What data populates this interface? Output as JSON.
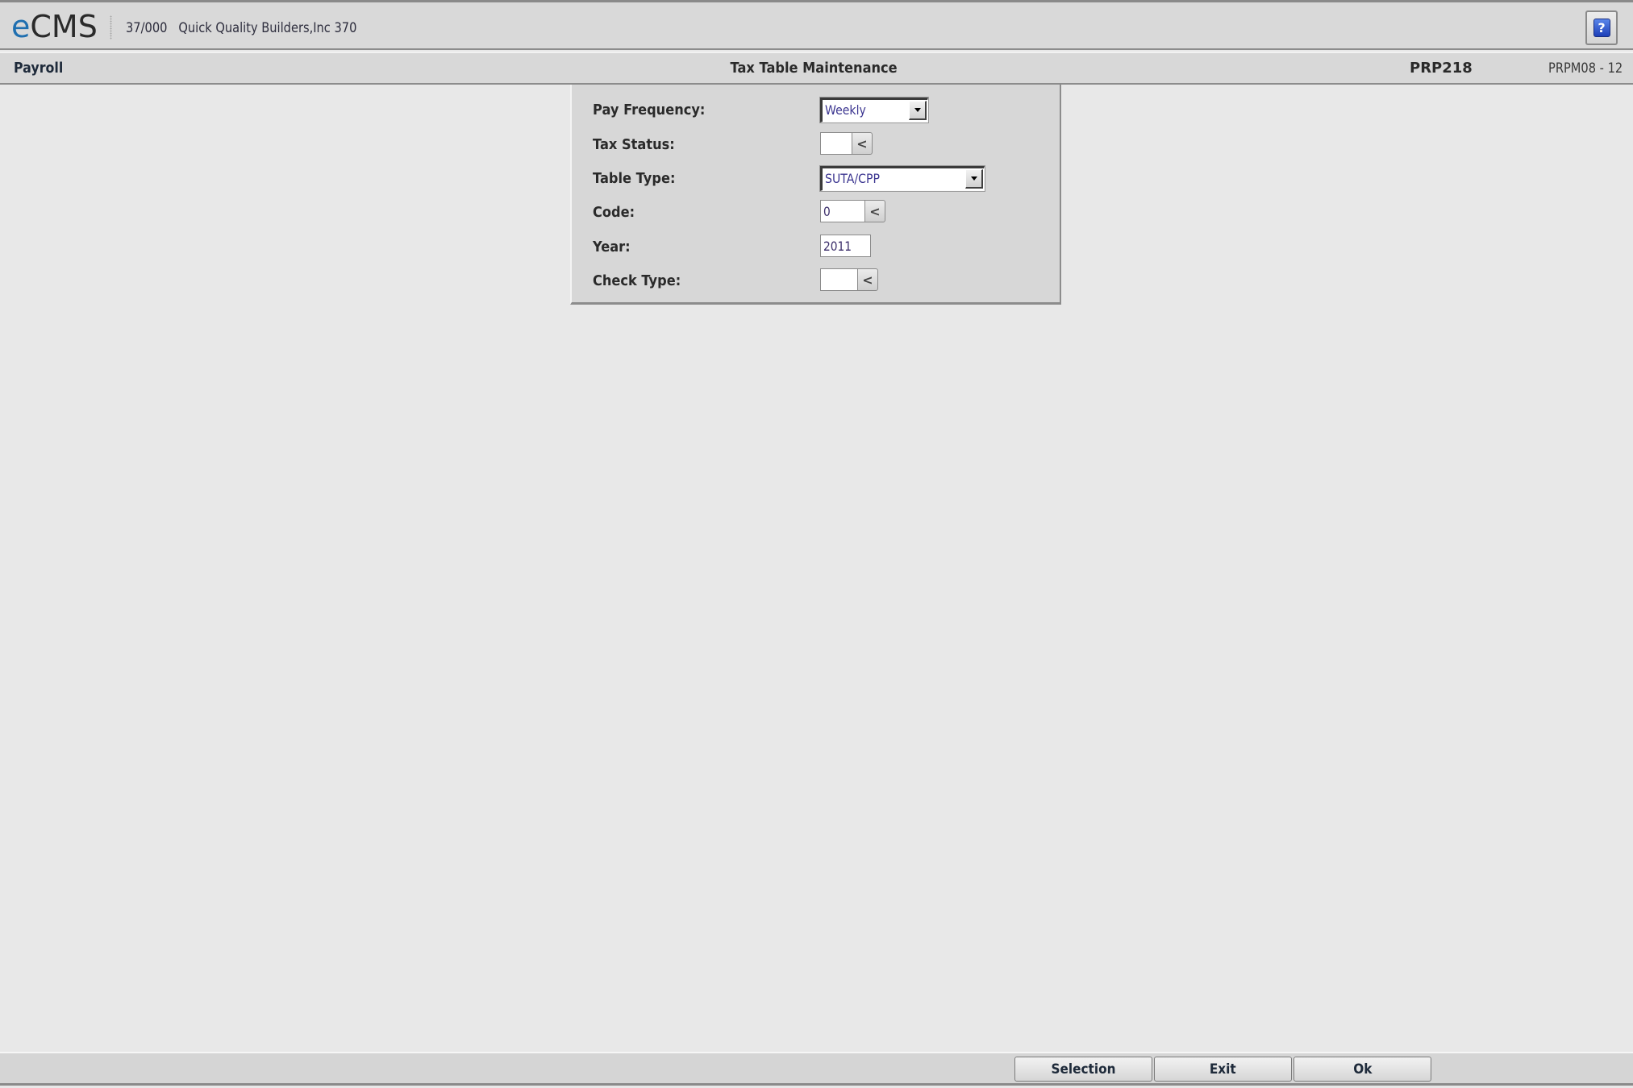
{
  "app": {
    "logo_prefix": "e",
    "logo_rest": "CMS",
    "company": "37/000   Quick Quality Builders,Inc 370",
    "help_icon_glyph": "?"
  },
  "subheader": {
    "module": "Payroll",
    "title": "Tax Table Maintenance",
    "program_id": "PRP218",
    "program_version": "PRPM08 - 12"
  },
  "form": {
    "pay_frequency": {
      "label": "Pay Frequency:",
      "value": "Weekly"
    },
    "tax_status": {
      "label": "Tax Status:",
      "value": ""
    },
    "table_type": {
      "label": "Table Type:",
      "value": "SUTA/CPP"
    },
    "code": {
      "label": "Code:",
      "value": "0"
    },
    "year": {
      "label": "Year:",
      "value": "2011"
    },
    "check_type": {
      "label": "Check Type:",
      "value": ""
    },
    "lookup_glyph": "<"
  },
  "footer": {
    "selection_label": "Selection",
    "exit_label": "Exit",
    "ok_label": "Ok"
  },
  "colors": {
    "logo_accent": "#1f6fb0",
    "field_text": "#3b3590",
    "help_icon": "#2a4fd0"
  }
}
